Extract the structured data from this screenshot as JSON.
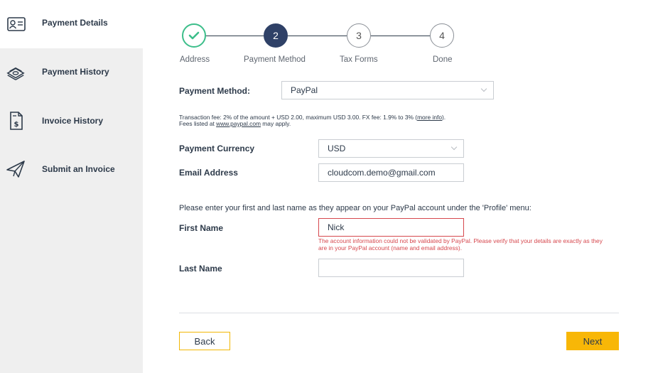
{
  "sidebar": {
    "items": [
      {
        "label": "Payment Details",
        "icon": "id-card-icon"
      },
      {
        "label": "Payment History",
        "icon": "money-stack-icon"
      },
      {
        "label": "Invoice History",
        "icon": "invoice-dollar-icon"
      },
      {
        "label": "Submit an Invoice",
        "icon": "paper-plane-icon"
      }
    ]
  },
  "stepper": {
    "steps": [
      {
        "number": "",
        "label": "Address",
        "state": "done"
      },
      {
        "number": "2",
        "label": "Payment Method",
        "state": "active"
      },
      {
        "number": "3",
        "label": "Tax Forms",
        "state": "future"
      },
      {
        "number": "4",
        "label": "Done",
        "state": "future"
      }
    ]
  },
  "form": {
    "payment_method_label": "Payment Method:",
    "payment_method_value": "PayPal",
    "fee_text_1": "Transaction fee: 2% of the amount + USD 2.00, maximum USD 3.00. FX fee: 1.9% to 3% (",
    "fee_more_info": "more info",
    "fee_text_2": ").",
    "fee_line2_prefix": "Fees listed at ",
    "fee_link": "www.paypal.com",
    "fee_line2_suffix": " may apply.",
    "currency_label": "Payment Currency",
    "currency_value": "USD",
    "email_label": "Email Address",
    "email_value": "cloudcom.demo@gmail.com",
    "name_note": "Please enter your first and last name as they appear on your PayPal account under the 'Profile' menu:",
    "first_name_label": "First Name",
    "first_name_value": "Nick",
    "error_message": "The account information could not be validated by PayPal. Please verify that your details are exactly as they are in your PayPal account (name and email address).",
    "last_name_label": "Last Name",
    "last_name_value": ""
  },
  "actions": {
    "back": "Back",
    "next": "Next"
  },
  "colors": {
    "accent": "#f8b707",
    "step_active": "#2f4167",
    "step_done": "#3cbe8a",
    "error": "#d6474d",
    "sidebar_bg": "#efefef"
  }
}
